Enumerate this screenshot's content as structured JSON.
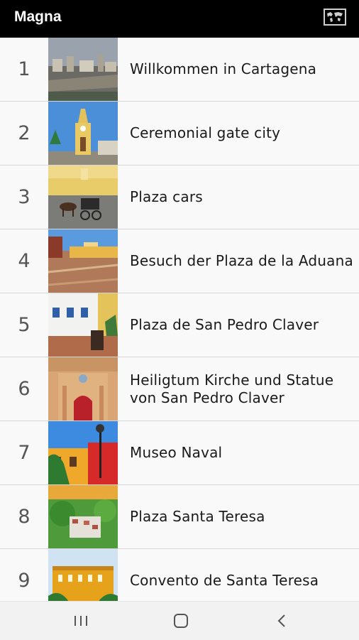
{
  "app": {
    "title": "Magna"
  },
  "header": {
    "map_icon": "world-map-icon"
  },
  "items": [
    {
      "number": "1",
      "title": "Willkommen in Cartagena",
      "thumbnail": "cartagena-skyline-photo"
    },
    {
      "number": "2",
      "title": "Ceremonial gate city",
      "thumbnail": "clock-tower-gate-photo"
    },
    {
      "number": "3",
      "title": "Plaza cars",
      "thumbnail": "horse-carriage-plaza-photo"
    },
    {
      "number": "4",
      "title": "Besuch der Plaza de la Aduana",
      "thumbnail": "plaza-de-la-aduana-photo"
    },
    {
      "number": "5",
      "title": "Plaza de San Pedro Claver",
      "thumbnail": "plaza-san-pedro-claver-photo"
    },
    {
      "number": "6",
      "title": "Heiligtum Kirche und Statue von San Pedro Claver",
      "thumbnail": "church-facade-photo"
    },
    {
      "number": "7",
      "title": "Museo Naval",
      "thumbnail": "museo-naval-photo"
    },
    {
      "number": "8",
      "title": "Plaza Santa Teresa",
      "thumbnail": "plaza-santa-teresa-photo"
    },
    {
      "number": "9",
      "title": "Convento de Santa Teresa",
      "thumbnail": "convento-santa-teresa-photo"
    }
  ],
  "navbar": {
    "recents": "recent-apps-icon",
    "home": "home-icon",
    "back": "back-icon"
  },
  "colors": {
    "appbar": "#000000",
    "row_bg": "#f9f9f9",
    "divider": "#d6d6d6",
    "text": "#1a1a1a",
    "number": "#555555"
  }
}
